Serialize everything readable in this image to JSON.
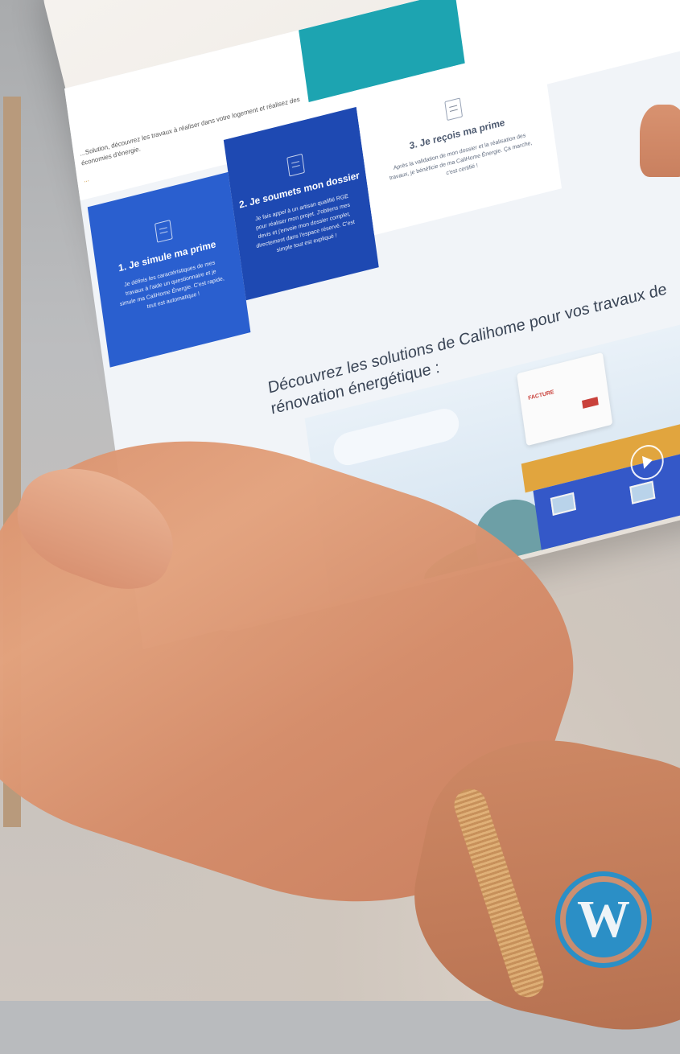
{
  "screen": {
    "intro_text": "...Solution, découvrez les travaux à réaliser dans votre logement et réalisez des économies d'énergie.",
    "intro_link": "...",
    "steps": [
      {
        "title": "1. Je simule ma prime",
        "text": "Je définis les caractéristiques de mes travaux à l'aide un questionnaire et je simule ma CaliHome Énergie. C'est rapide, tout est automatique !"
      },
      {
        "title": "2. Je soumets mon dossier",
        "text": "Je fais appel à un artisan qualifié RGE pour réaliser mon projet. J'obtiens mes devis et j'envoie mon dossier complet, directement dans l'espace réservé. C'est simple tout est expliqué !"
      },
      {
        "title": "3. Je reçois ma prime",
        "text": "Après la validation de mon dossier et la réalisation des travaux, je bénéficie de ma CaliHome Énergie. Ça marche, c'est certifié !"
      }
    ],
    "section_heading": "Découvrez les solutions de Calihome pour vos travaux de rénovation énergétique :",
    "illustration": {
      "doc_label": "FACTURE"
    }
  },
  "colors": {
    "accent_bar": "#b89a7c",
    "card_1": "#2a5fcf",
    "card_2": "#1e49b2",
    "teal": "#1da4b1",
    "wordpress_blue": "#2b8fc6"
  },
  "logo": {
    "name": "wordpress-logo",
    "glyph": "W"
  }
}
